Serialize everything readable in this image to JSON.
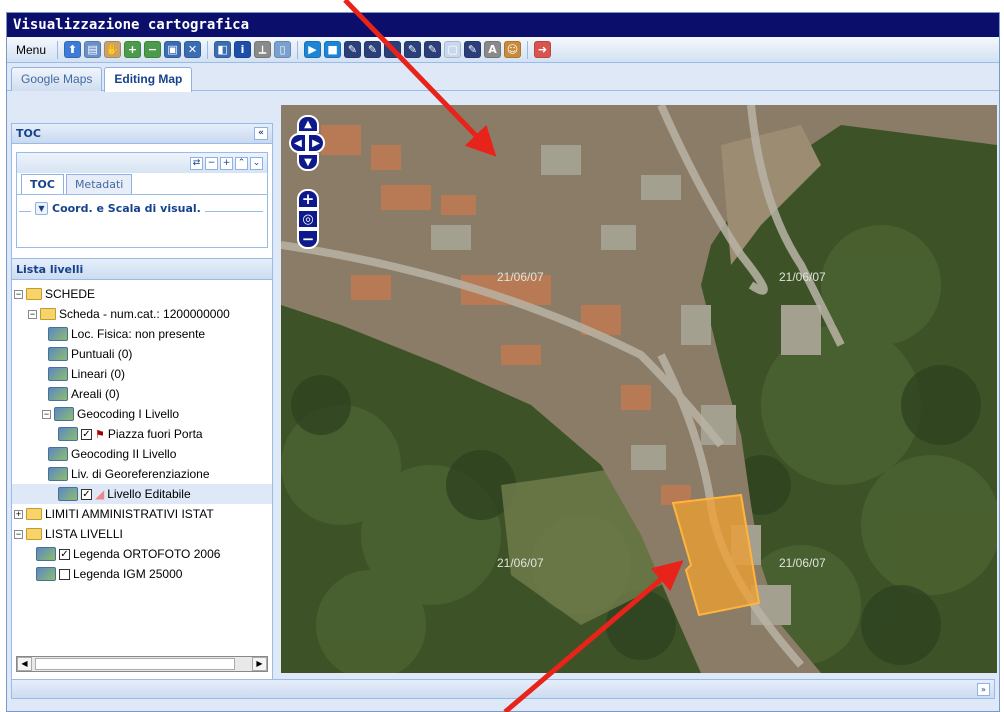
{
  "app": {
    "title": "Visualizzazione cartografica"
  },
  "toolbar": {
    "menu_label": "Menu",
    "tools": [
      {
        "icon": "upload-icon",
        "color": "#3d7bd9",
        "glyph": "⬆"
      },
      {
        "icon": "save-icon",
        "color": "#6b8fc7",
        "glyph": "▤"
      },
      {
        "icon": "pan-hand-icon",
        "color": "#c9a36a",
        "glyph": "✋"
      },
      {
        "icon": "zoom-in-icon",
        "color": "#4c9a4c",
        "glyph": "+"
      },
      {
        "icon": "zoom-out-icon",
        "color": "#4c9a4c",
        "glyph": "−"
      },
      {
        "icon": "zoom-box-icon",
        "color": "#3b6db3",
        "glyph": "▣"
      },
      {
        "icon": "full-extent-icon",
        "color": "#3b6db3",
        "glyph": "✕"
      },
      {
        "icon": "sep"
      },
      {
        "icon": "layers-icon",
        "color": "#3b6db3",
        "glyph": "◧"
      },
      {
        "icon": "info-icon",
        "color": "#1d4fa8",
        "glyph": "i"
      },
      {
        "icon": "measure-icon",
        "color": "#8a8a8a",
        "glyph": "⟂"
      },
      {
        "icon": "select-icon",
        "color": "#7aa0d0",
        "glyph": "▯"
      },
      {
        "icon": "sep"
      },
      {
        "icon": "play-icon",
        "color": "#1d84d6",
        "glyph": "▶"
      },
      {
        "icon": "stop-icon",
        "color": "#1d84d6",
        "glyph": "■"
      },
      {
        "icon": "edit-point-icon",
        "color": "#2b3f7a",
        "glyph": "✎"
      },
      {
        "icon": "edit-line-icon",
        "color": "#2b3f7a",
        "glyph": "✎"
      },
      {
        "icon": "edit-polygon-icon",
        "color": "#2b3f7a",
        "glyph": "✎"
      },
      {
        "icon": "edit-move-icon",
        "color": "#2b3f7a",
        "glyph": "✎"
      },
      {
        "icon": "delete-feature-icon",
        "color": "#2b3f7a",
        "glyph": "✎"
      },
      {
        "icon": "copy-icon",
        "color": "#c8d8ee",
        "glyph": "▢"
      },
      {
        "icon": "paste-icon",
        "color": "#2b3f7a",
        "glyph": "✎"
      },
      {
        "icon": "compass-icon",
        "color": "#8a8a8a",
        "glyph": "A"
      },
      {
        "icon": "person-icon",
        "color": "#c98a3a",
        "glyph": "☺"
      },
      {
        "icon": "sep"
      },
      {
        "icon": "exit-icon",
        "color": "#d9534f",
        "glyph": "➜"
      }
    ]
  },
  "tabs": [
    {
      "label": "Google Maps",
      "active": false
    },
    {
      "label": "Editing Map",
      "active": true
    }
  ],
  "toc": {
    "header": "TOC",
    "collapse_glyph": "«",
    "inner_tools": [
      "⇄",
      "−",
      "+",
      "⌃",
      "⌄"
    ],
    "inner_tabs": [
      {
        "label": "TOC",
        "active": true
      },
      {
        "label": "Metadati",
        "active": false
      }
    ],
    "coord_legend": "Coord. e Scala di visual.",
    "layers_title": "Lista livelli",
    "tree": [
      {
        "label": "SCHEDE",
        "type": "folder",
        "expander": "−"
      },
      {
        "label": "Scheda - num.cat.: 1200000000",
        "type": "folder",
        "expander": "−"
      },
      {
        "label": "Loc. Fisica: non presente",
        "type": "layer"
      },
      {
        "label": "Puntuali (0)",
        "type": "layer"
      },
      {
        "label": "Lineari (0)",
        "type": "layer"
      },
      {
        "label": "Areali (0)",
        "type": "layer"
      },
      {
        "label": "Geocoding I Livello",
        "type": "layer",
        "expander": "−"
      },
      {
        "label": "Piazza fuori Porta",
        "type": "layer",
        "checkbox": true,
        "flag": true
      },
      {
        "label": "Geocoding II Livello",
        "type": "layer"
      },
      {
        "label": "Liv. di Georeferenziazione",
        "type": "layer"
      },
      {
        "label": "Livello Editabile",
        "type": "layer",
        "checkbox": true,
        "pin": true,
        "selected": true
      },
      {
        "label": "LIMITI AMMINISTRATIVI ISTAT",
        "type": "folder",
        "expander": "+"
      },
      {
        "label": "LISTA LIVELLI",
        "type": "folder",
        "expander": "−"
      },
      {
        "label": "Legenda ORTOFOTO 2006",
        "type": "layer",
        "checkbox": true
      },
      {
        "label": "Legenda IGM 25000",
        "type": "layer",
        "checkbox": false
      }
    ]
  },
  "map": {
    "date_labels": [
      "21/06/07",
      "21/06/07",
      "21/06/07",
      "21/06/07"
    ],
    "highlight_color": "#f0a030",
    "arrow_color": "#e8231a"
  },
  "statusbar": {
    "expander": "»"
  }
}
